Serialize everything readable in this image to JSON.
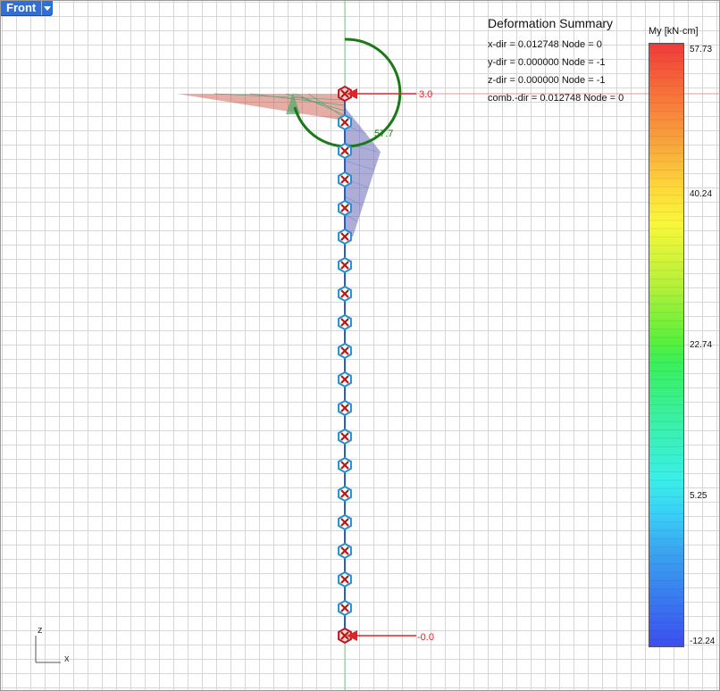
{
  "viewport": {
    "view_name": "Front",
    "dropdown_icon": "chevron-down-icon"
  },
  "deformation_summary": {
    "title": "Deformation Summary",
    "rows": [
      "x-dir = 0.012748  Node = 0",
      "y-dir = 0.000000  Node = -1",
      "z-dir = 0.000000  Node = -1",
      "comb.-dir = 0.012748  Node = 0"
    ]
  },
  "legend": {
    "title": "My [kN·cm]",
    "ticks": [
      "57.73",
      "40.24",
      "22.74",
      "5.25",
      "-12.24"
    ]
  },
  "annotations": {
    "top_force": "3.0",
    "bottom_force": "-0.0",
    "moment": "57.7"
  },
  "axes": {
    "z": "z",
    "x": "x"
  },
  "colors": {
    "member": "#1f5fd6",
    "node_ring": "#1f8fd0",
    "support_x": "#b51a1a",
    "load_arrow": "#e0242a",
    "moment_arc": "#1a7a1a",
    "tab": "#2f6fd6"
  }
}
